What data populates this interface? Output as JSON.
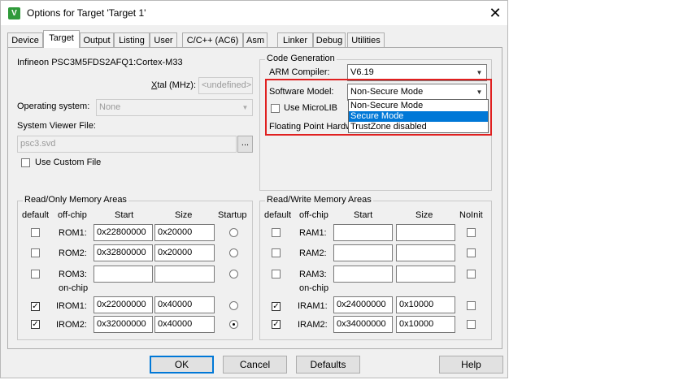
{
  "window": {
    "title": "Options for Target 'Target 1'",
    "close": "✕"
  },
  "tabs": [
    "Device",
    "Target",
    "Output",
    "Listing",
    "User",
    "C/C++ (AC6)",
    "Asm",
    "Linker",
    "Debug",
    "Utilities"
  ],
  "device": {
    "name": "Infineon PSC3M5FDS2AFQ1:Cortex-M33",
    "xtal_label": "Xtal (MHz):",
    "xtal_value": "<undefined>",
    "os_label": "Operating system:",
    "os_value": "None",
    "svd_label": "System Viewer File:",
    "svd_value": "psc3.svd",
    "browse": "...",
    "custom_file_label": "Use Custom File"
  },
  "codegen": {
    "title": "Code Generation",
    "compiler_label": "ARM Compiler:",
    "compiler_value": "V6.19",
    "swmodel_label": "Software Model:",
    "swmodel_value": "Non-Secure Mode",
    "microlib_label": "Use MicroLIB",
    "fp_label": "Floating Point Hardw",
    "options": [
      "Non-Secure Mode",
      "Secure Mode",
      "TrustZone disabled"
    ],
    "selected_option": "Secure Mode"
  },
  "rom": {
    "title": "Read/Only Memory Areas",
    "headers": {
      "default": "default",
      "offchip": "off-chip",
      "start": "Start",
      "size": "Size",
      "startup": "Startup"
    },
    "onchip_label": "on-chip",
    "rows": [
      {
        "label": "ROM1:",
        "default": false,
        "start": "0x22800000",
        "size": "0x20000",
        "startup": false
      },
      {
        "label": "ROM2:",
        "default": false,
        "start": "0x32800000",
        "size": "0x20000",
        "startup": false
      },
      {
        "label": "ROM3:",
        "default": false,
        "start": "",
        "size": "",
        "startup": false
      },
      {
        "label": "IROM1:",
        "default": true,
        "start": "0x22000000",
        "size": "0x40000",
        "startup": false
      },
      {
        "label": "IROM2:",
        "default": true,
        "start": "0x32000000",
        "size": "0x40000",
        "startup": true
      }
    ]
  },
  "ram": {
    "title": "Read/Write Memory Areas",
    "headers": {
      "default": "default",
      "offchip": "off-chip",
      "start": "Start",
      "size": "Size",
      "noinit": "NoInit"
    },
    "onchip_label": "on-chip",
    "rows": [
      {
        "label": "RAM1:",
        "default": false,
        "start": "",
        "size": "",
        "noinit": false
      },
      {
        "label": "RAM2:",
        "default": false,
        "start": "",
        "size": "",
        "noinit": false
      },
      {
        "label": "RAM3:",
        "default": false,
        "start": "",
        "size": "",
        "noinit": false
      },
      {
        "label": "IRAM1:",
        "default": true,
        "start": "0x24000000",
        "size": "0x10000",
        "noinit": false
      },
      {
        "label": "IRAM2:",
        "default": true,
        "start": "0x34000000",
        "size": "0x10000",
        "noinit": false
      }
    ]
  },
  "buttons": {
    "ok": "OK",
    "cancel": "Cancel",
    "defaults": "Defaults",
    "help": "Help"
  },
  "check_mark": "✓",
  "colors": {
    "selection": "#0078d7",
    "highlight_box": "#e02020"
  }
}
